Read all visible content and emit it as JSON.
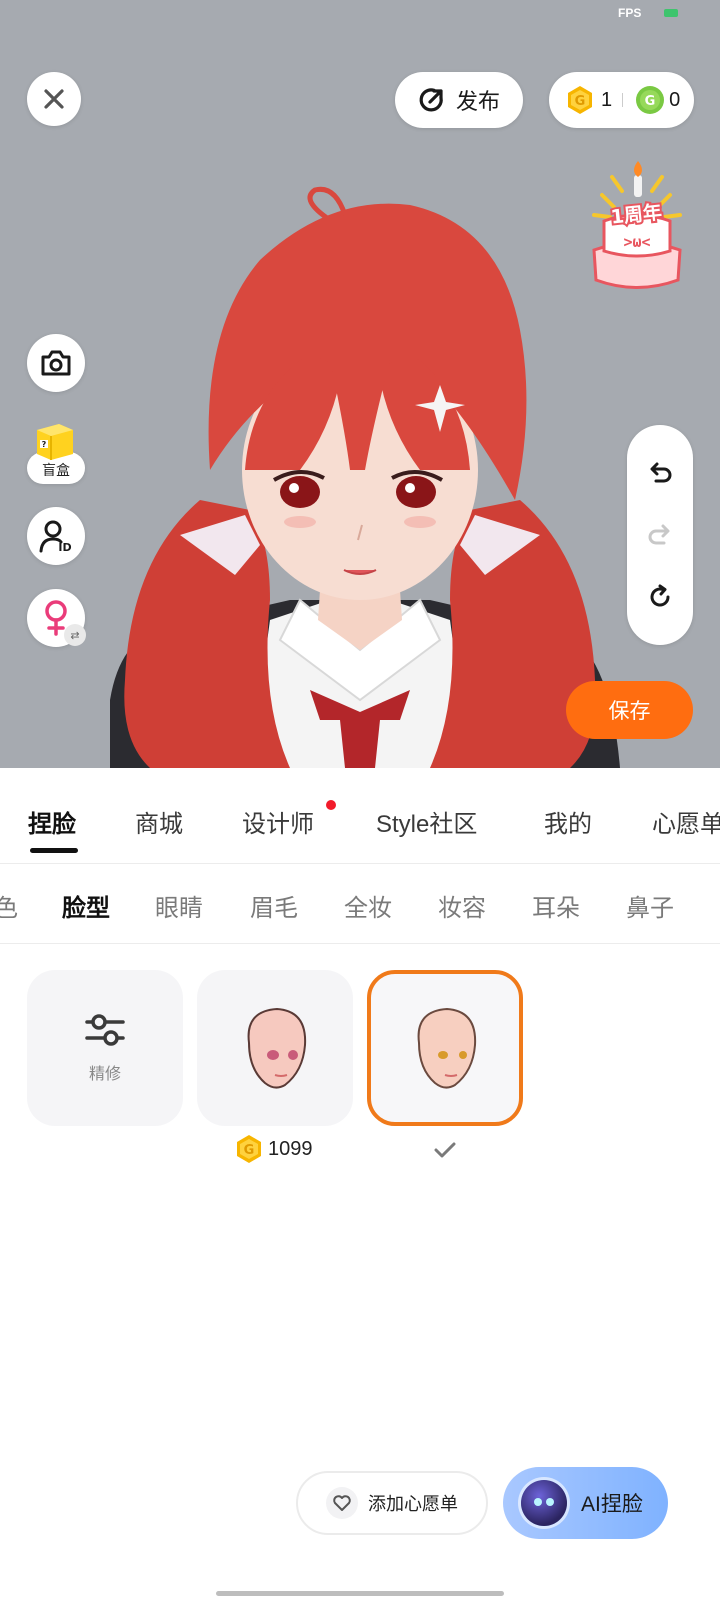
{
  "status": {
    "fps_label": "FPS"
  },
  "preview": {
    "publish_label": "发布",
    "gold_count": "1",
    "green_count": "0",
    "cake_badge": "1周年",
    "blindbox_label": "盲盒",
    "save_label": "保存"
  },
  "main_tabs": [
    {
      "label": "捏脸",
      "active": true
    },
    {
      "label": "商城"
    },
    {
      "label": "设计师",
      "has_dot": true
    },
    {
      "label": "Style社区"
    },
    {
      "label": "我的"
    },
    {
      "label": "心愿单"
    }
  ],
  "sub_tabs": [
    {
      "label": "色"
    },
    {
      "label": "脸型",
      "active": true
    },
    {
      "label": "眼睛"
    },
    {
      "label": "眉毛"
    },
    {
      "label": "全妆"
    },
    {
      "label": "妆容"
    },
    {
      "label": "耳朵"
    },
    {
      "label": "鼻子"
    }
  ],
  "items": {
    "refine_label": "精修",
    "price_1": "1099"
  },
  "bottom": {
    "wishlist_label": "添加心愿单",
    "ai_label": "AI捏脸"
  },
  "colors": {
    "accent_orange": "#ff6d10",
    "selected_border": "#f07a1a",
    "notification_dot": "#f21b2a",
    "gold_coin": "#f7b500",
    "green_coin": "#7ac943",
    "hair": "#d9483e"
  },
  "icons": {
    "close": "close-icon",
    "publish": "publish-icon",
    "camera": "camera-icon",
    "id": "profile-id-icon",
    "gender": "female-icon",
    "undo": "undo-icon",
    "redo": "redo-icon",
    "reset": "reset-icon",
    "refine": "sliders-icon",
    "heart": "heart-icon"
  }
}
